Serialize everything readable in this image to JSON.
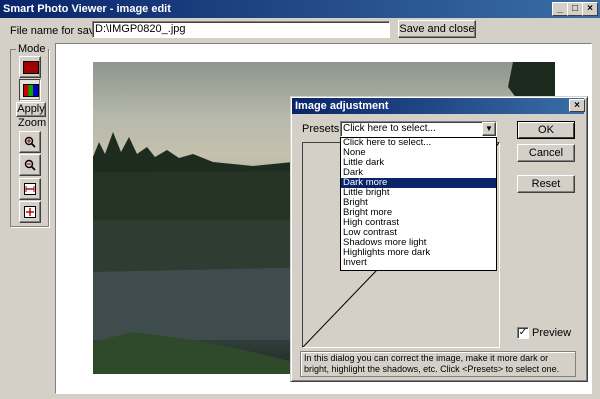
{
  "window": {
    "title": "Smart Photo Viewer - image edit",
    "controls": [
      "_",
      "□",
      "×"
    ]
  },
  "toolbar": {
    "file_label": "File name for saving:",
    "file_value": "D:\\IMGP0820_.jpg",
    "save_close": "Save and close"
  },
  "sidebar": {
    "mode_label": "Mode",
    "apply_label": "Apply",
    "zoom_label": "Zoom",
    "tools": [
      "crop-icon",
      "color-adjust-icon",
      "zoom-in-icon",
      "zoom-out-icon",
      "fit-width-icon",
      "fit-window-icon"
    ]
  },
  "dialog": {
    "title": "Image adjustment",
    "close": "×",
    "presets_label": "Presets:",
    "presets_value": "Click here to select...",
    "options": [
      "Click here to select...",
      "None",
      "Little dark",
      "Dark",
      "Dark more",
      "Little bright",
      "Bright",
      "Bright more",
      "High contrast",
      "Low contrast",
      "Shadows more light",
      "Highlights more dark",
      "Invert"
    ],
    "selected_index": 4,
    "ok": "OK",
    "cancel": "Cancel",
    "reset": "Reset",
    "preview_label": "Preview",
    "preview_checked": true,
    "help": "In this dialog you can correct the image, make it more dark or bright, highlight the shadows, etc. Click <Presets> to select one."
  },
  "colors": {
    "title_bar": "#0a246a",
    "face": "#d4d0c8",
    "selection": "#0a246a"
  }
}
